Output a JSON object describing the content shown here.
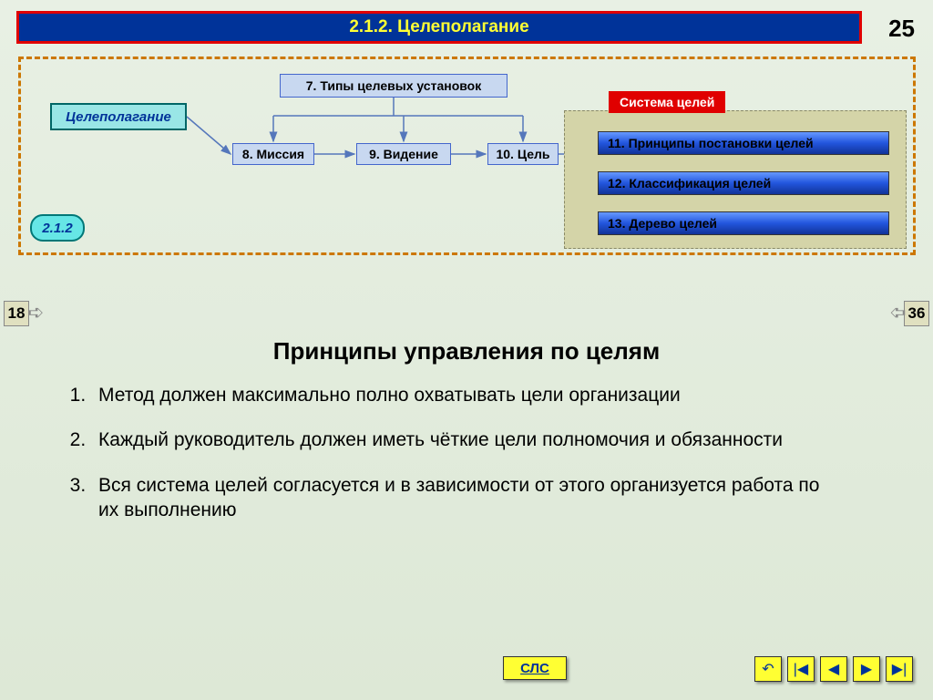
{
  "header": {
    "title": "2.1.2. Целеполагание"
  },
  "page_number": "25",
  "diagram": {
    "root": "Целеполагание",
    "types_box": "7. Типы целевых установок",
    "mission": "8. Миссия",
    "vision": "9. Видение",
    "goal": "10. Цель",
    "system_label": "Система целей",
    "system_items": [
      "11. Принципы постановки целей",
      "12. Классификация целей",
      "13. Дерево целей"
    ],
    "section_badge": "2.1.2"
  },
  "nav": {
    "prev": "18",
    "next": "36"
  },
  "content": {
    "title": "Принципы управления по целям",
    "principles": [
      "Метод должен максимально полно охватывать цели организации",
      "Каждый руководитель должен иметь чёткие цели полномочия и обязанности",
      "Вся система целей согласуется и в зависимости от этого организуется работа по их выполнению"
    ]
  },
  "footer": {
    "sls": "СЛС",
    "icons": {
      "back": "↶",
      "first": "|◀",
      "prev": "◀",
      "next": "▶",
      "last": "▶|"
    }
  },
  "colors": {
    "header_bg": "#003399",
    "header_border": "#e00000",
    "header_text": "#ffff33",
    "box_bg": "#c8d8f0",
    "root_bg": "#99e6e6",
    "system_bg": "#d4d4a8",
    "button_bg": "#ffff33",
    "dashed_border": "#cc7700"
  }
}
